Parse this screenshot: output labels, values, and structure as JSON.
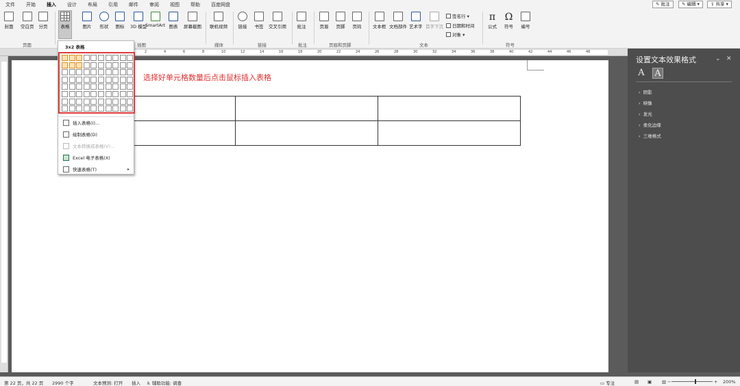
{
  "tabs": [
    "文件",
    "开始",
    "插入",
    "设计",
    "布局",
    "引用",
    "邮件",
    "审阅",
    "视图",
    "帮助",
    "百度网盘"
  ],
  "active_tab": "插入",
  "top_right": {
    "comment": "批注",
    "edit": "编辑",
    "share": "共享"
  },
  "ribbon": {
    "pages_group": {
      "cover": "封面",
      "blank": "空白页",
      "break": "分页",
      "label": "页面"
    },
    "table_button": "表格",
    "illustrations": {
      "picture": "图片",
      "shapes": "形状",
      "icons": "图标",
      "3d": "3D 模型",
      "smartart": "SmartArt",
      "chart": "图表",
      "screenshot": "屏幕截图",
      "label": "插图"
    },
    "media": {
      "video": "联机视频",
      "label": "媒体"
    },
    "links": {
      "link": "链接",
      "bookmark": "书签",
      "crossref": "交叉引用",
      "label": "链接"
    },
    "comments": {
      "comment": "批注",
      "label": "批注"
    },
    "header_footer": {
      "header": "页眉",
      "footer": "页脚",
      "page_number": "页码",
      "label": "页眉和页脚"
    },
    "text": {
      "textbox": "文本框",
      "quickparts": "文档部件",
      "wordart": "艺术字",
      "dropcap": "首字下沉",
      "signature": "签名行",
      "datetime": "日期和时间",
      "object": "对象",
      "label": "文本"
    },
    "symbols": {
      "equation": "公式",
      "symbol": "符号",
      "number": "编号",
      "label": "符号"
    }
  },
  "ruler_numbers": [
    "2",
    "4",
    "6",
    "8",
    "10",
    "12",
    "14",
    "16",
    "18",
    "20",
    "22",
    "24",
    "26",
    "28",
    "30",
    "32",
    "34",
    "36",
    "38",
    "40",
    "42",
    "44",
    "46",
    "48"
  ],
  "table_menu": {
    "grid_title": "3x2 表格",
    "grid_cols": 10,
    "grid_rows": 8,
    "selected_cols": 3,
    "selected_rows": 2,
    "items": [
      {
        "label": "插入表格(I)...",
        "enabled": true,
        "icon": "table-icon"
      },
      {
        "label": "绘制表格(D)",
        "enabled": true,
        "icon": "pencil-table-icon"
      },
      {
        "label": "文本转换成表格(V)...",
        "enabled": false,
        "icon": "convert-icon"
      },
      {
        "label": "Excel 电子表格(X)",
        "enabled": true,
        "icon": "excel-icon"
      },
      {
        "label": "快速表格(T)",
        "enabled": true,
        "icon": "quick-table-icon"
      }
    ]
  },
  "annotation": "选择好单元格数量后点击鼠标插入表格",
  "document_table": {
    "rows": 2,
    "cols": 3
  },
  "pane": {
    "title": "设置文本效果格式",
    "sections": [
      "阴影",
      "映像",
      "发光",
      "柔化边缘",
      "三维格式"
    ]
  },
  "status": {
    "page": "第 22 页，共 22 页",
    "words": "2990 个字",
    "predict": "文本预测: 打开",
    "insert": "插入",
    "accessibility": "辅助功能: 调查",
    "focus": "专注",
    "zoom": "200%"
  },
  "colors": {
    "accent": "#2b579a",
    "annotation": "#e03030",
    "grid_highlight": "#fde3b8"
  }
}
